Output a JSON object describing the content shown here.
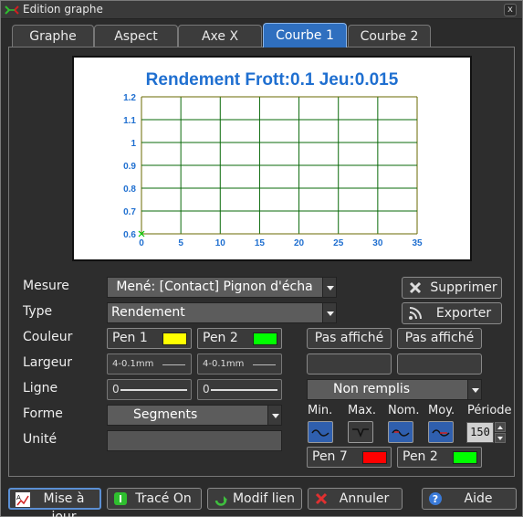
{
  "window": {
    "title": "Edition graphe",
    "close_glyph": "x"
  },
  "tabs": [
    {
      "label": "Graphe"
    },
    {
      "label": "Aspect"
    },
    {
      "label": "Axe X"
    },
    {
      "label": "Courbe 1",
      "active": true
    },
    {
      "label": "Courbe 2"
    }
  ],
  "chart_data": {
    "type": "line",
    "title": "Rendement Frott:0.1 Jeu:0.015",
    "xlabel": "",
    "ylabel": "",
    "xlim": [
      0,
      35
    ],
    "ylim": [
      0.6,
      1.2
    ],
    "x_ticks": [
      "0",
      "5",
      "10",
      "15",
      "20",
      "25",
      "30",
      "35"
    ],
    "y_ticks": [
      "0.6",
      "0.7",
      "0.8",
      "0.9",
      "1",
      "1.1",
      "1.2"
    ],
    "grid": true,
    "series": [
      {
        "points": [
          [
            0,
            0.6
          ]
        ]
      }
    ],
    "colors": {
      "title": "#1f6fd0",
      "ticks": "#1f6fd0",
      "grid": "#0a6a0a",
      "frame": "#6a6a00",
      "marker": "#00cc00"
    }
  },
  "form": {
    "mesure": {
      "label": "Mesure",
      "value": "Mené: [Contact] Pignon d'écha"
    },
    "type": {
      "label": "Type",
      "value": "Rendement"
    },
    "couleur": {
      "label": "Couleur",
      "pen1": "Pen 1",
      "pen1_color": "#ffff00",
      "pen2": "Pen 2",
      "pen2_color": "#00ff00"
    },
    "largeur": {
      "label": "Largeur",
      "value1": "4-0.1mm",
      "value2": "4-0.1mm"
    },
    "ligne": {
      "label": "Ligne",
      "value1": "0",
      "value2": "0"
    },
    "forme": {
      "label": "Forme",
      "value": "Segments"
    },
    "unite": {
      "label": "Unité",
      "value": ""
    }
  },
  "right_panel": {
    "supprimer": "Supprimer",
    "exporter": "Exporter",
    "pas_affiche_1": "Pas affiché",
    "pas_affiche_2": "Pas affiché",
    "remplissage": "Non remplis",
    "stat_labels": {
      "min": "Min.",
      "max": "Max.",
      "nom": "Nom.",
      "moy": "Moy.",
      "periode": "Période"
    },
    "periode_value": "150",
    "pen_a": "Pen 7",
    "pen_a_color": "#ff0000",
    "pen_b": "Pen 2",
    "pen_b_color": "#00ff00"
  },
  "footer": {
    "mise_a_jour": "Mise à jour",
    "trace_on": "Tracé On",
    "modif_lien": "Modif lien",
    "annuler": "Annuler",
    "aide": "Aide"
  }
}
